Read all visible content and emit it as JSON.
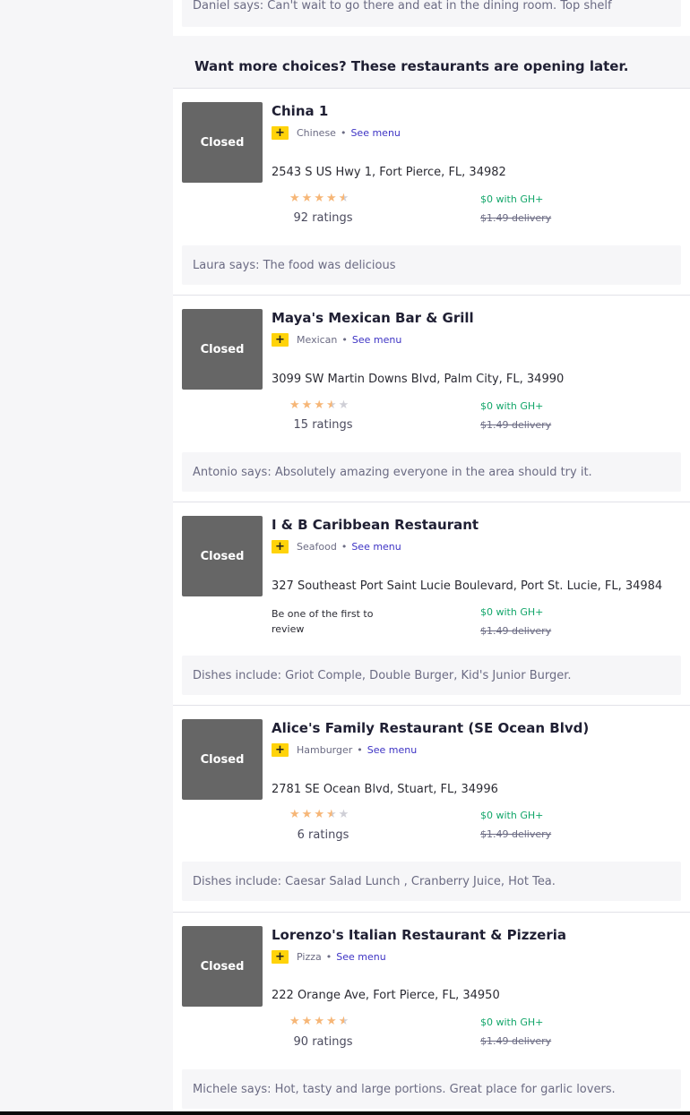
{
  "top_review": "Daniel says: Can't wait to go there and eat in the dining room. Top shelf",
  "later_banner": "Want more choices? These restaurants are opening later.",
  "colors": {
    "plus_badge": "#ffd30a",
    "see_menu": "#3d33c4",
    "gh_plus": "#13a66a",
    "closed_box": "#666666",
    "star": "#f6b677"
  },
  "restaurants": [
    {
      "status": "Closed",
      "name": "China 1",
      "cuisine": "Chinese",
      "dot": "•",
      "see_menu": "See menu",
      "badge_icon": "grubhub-plus-icon",
      "badge_glyph": "+",
      "address": "2543 S US Hwy 1, Fort Pierce, FL, 34982",
      "rating_stars": 4.5,
      "ratings_count": "92 ratings",
      "gh_plus": "$0 with GH+",
      "delivery_fee": "$1.49 delivery",
      "quote": "Laura says: The food was delicious"
    },
    {
      "status": "Closed",
      "name": "Maya's Mexican Bar & Grill",
      "cuisine": "Mexican",
      "dot": "•",
      "see_menu": "See menu",
      "badge_icon": "grubhub-plus-icon",
      "badge_glyph": "+",
      "address": "3099 SW Martin Downs Blvd, Palm City, FL, 34990",
      "rating_stars": 3.5,
      "ratings_count": "15 ratings",
      "gh_plus": "$0 with GH+",
      "delivery_fee": "$1.49 delivery",
      "quote": "Antonio says: Absolutely amazing everyone in the area should try it."
    },
    {
      "status": "Closed",
      "name": "I & B Caribbean Restaurant",
      "cuisine": "Seafood",
      "dot": "•",
      "see_menu": "See menu",
      "badge_icon": "grubhub-plus-icon",
      "badge_glyph": "+",
      "address": "327 Southeast Port Saint Lucie Boulevard, Port St. Lucie, FL, 34984",
      "first_review": "Be one of the first to review",
      "gh_plus": "$0 with GH+",
      "delivery_fee": "$1.49 delivery",
      "quote": "Dishes include: Griot Comple, Double Burger, Kid's Junior Burger."
    },
    {
      "status": "Closed",
      "name": "Alice's Family Restaurant (SE Ocean Blvd)",
      "cuisine": "Hamburger",
      "dot": "•",
      "see_menu": "See menu",
      "badge_icon": "grubhub-plus-icon",
      "badge_glyph": "+",
      "address": "2781 SE Ocean Blvd, Stuart, FL, 34996",
      "rating_stars": 3.5,
      "ratings_count": "6 ratings",
      "gh_plus": "$0 with GH+",
      "delivery_fee": "$1.49 delivery",
      "quote": "Dishes include: Caesar Salad Lunch , Cranberry Juice, Hot Tea."
    },
    {
      "status": "Closed",
      "name": "Lorenzo's Italian Restaurant & Pizzeria",
      "cuisine": "Pizza",
      "dot": "•",
      "see_menu": "See menu",
      "badge_icon": "grubhub-plus-icon",
      "badge_glyph": "+",
      "address": "222 Orange Ave, Fort Pierce, FL, 34950",
      "rating_stars": 4.5,
      "ratings_count": "90 ratings",
      "gh_plus": "$0 with GH+",
      "delivery_fee": "$1.49 delivery",
      "quote": "Michele says: Hot, tasty and large portions. Great place for garlic lovers."
    }
  ]
}
